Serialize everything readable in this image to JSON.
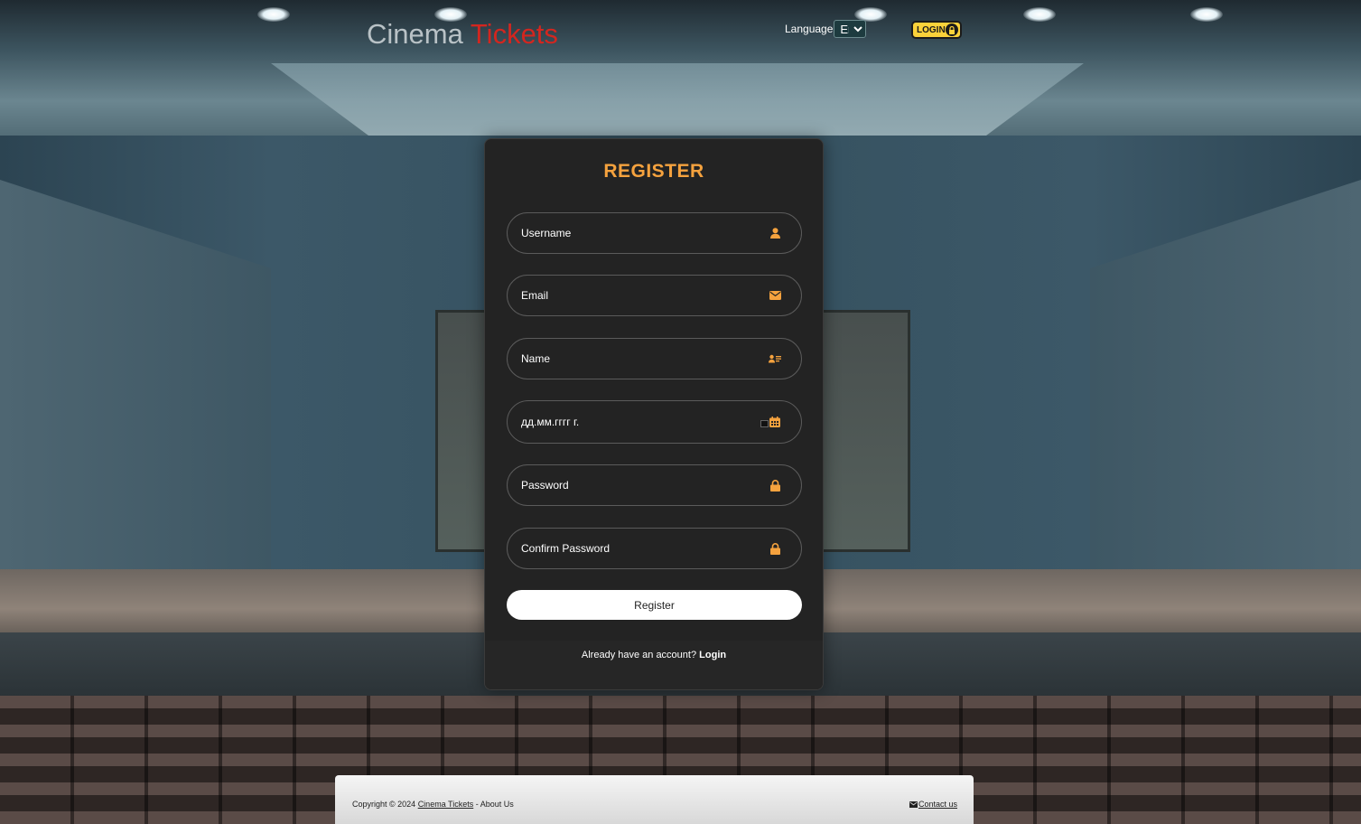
{
  "header": {
    "logo_word1": "Cinema",
    "logo_word2": "Tickets",
    "language_label": "Language",
    "language_selected": "En",
    "login_badge_label": "LOGIN"
  },
  "register": {
    "title": "REGISTER",
    "fields": {
      "username": "Username",
      "email": "Email",
      "name": "Name",
      "birthdate": "дд.мм.гггг г.",
      "password": "Password",
      "confirm_password": "Confirm Password"
    },
    "submit_label": "Register",
    "have_account_text": "Already have an account?",
    "login_link": "Login"
  },
  "footer": {
    "copyright_text": "Copyright © 2024",
    "site_link": "Cinema Tickets",
    "separator": " - ",
    "about_link": "About Us",
    "contact_link": "Contact us"
  },
  "colors": {
    "accent_orange": "#f5a23e",
    "logo_red": "#d3261f",
    "card_bg": "#232323",
    "login_badge_yellow": "#fbd23a"
  },
  "icons": {
    "username": "user-icon",
    "email": "envelope-icon",
    "name": "id-card-icon",
    "birthdate": "calendar-icon",
    "password": "lock-icon",
    "confirm_password": "lock-icon",
    "contact": "envelope-icon"
  }
}
